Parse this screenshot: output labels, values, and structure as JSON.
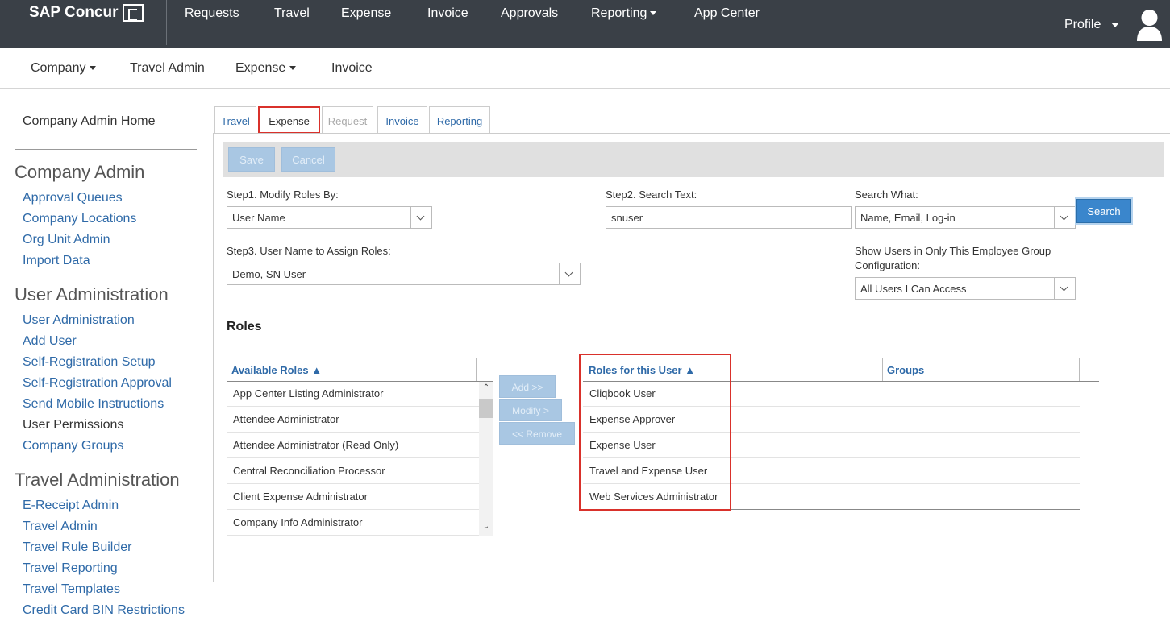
{
  "brand": {
    "name": "SAP Concur"
  },
  "top_nav": {
    "items": [
      "Requests",
      "Travel",
      "Expense",
      "Invoice",
      "Approvals",
      "Reporting",
      "App Center"
    ],
    "profile_label": "Profile"
  },
  "sub_nav": {
    "items": [
      "Company",
      "Travel Admin",
      "Expense",
      "Invoice"
    ]
  },
  "sidebar": {
    "home": "Company Admin Home",
    "sections": [
      {
        "title": "Company Admin",
        "links": [
          "Approval Queues",
          "Company Locations",
          "Org Unit Admin",
          "Import Data"
        ]
      },
      {
        "title": "User Administration",
        "links": [
          "User Administration",
          "Add User",
          "Self-Registration Setup",
          "Self-Registration Approval",
          "Send Mobile Instructions",
          "User Permissions",
          "Company Groups"
        ]
      },
      {
        "title": "Travel Administration",
        "links": [
          "E-Receipt Admin",
          "Travel Admin",
          "Travel Rule Builder",
          "Travel Reporting",
          "Travel Templates",
          "Credit Card BIN Restrictions"
        ]
      }
    ]
  },
  "tabs": [
    "Travel",
    "Expense",
    "Request",
    "Invoice",
    "Reporting"
  ],
  "toolbar": {
    "save": "Save",
    "cancel": "Cancel"
  },
  "form": {
    "step1_label": "Step1. Modify Roles By:",
    "step1_value": "User Name",
    "step2_label": "Step2. Search Text:",
    "step2_value": "snuser",
    "search_what_label": "Search What:",
    "search_what_value": "Name, Email, Log-in",
    "search_button": "Search",
    "step3_label": "Step3. User Name to Assign Roles:",
    "step3_value": "Demo, SN User",
    "group_label_line1": "Show Users in Only This Employee Group",
    "group_label_line2": "Configuration:",
    "group_value": "All Users I Can Access"
  },
  "roles": {
    "heading": "Roles",
    "available_header": "Available Roles",
    "available": [
      "App Center Listing Administrator",
      "Attendee Administrator",
      "Attendee Administrator (Read Only)",
      "Central Reconciliation Processor",
      "Client Expense Administrator",
      "Company Info Administrator"
    ],
    "buttons": {
      "add": "Add >>",
      "modify": "Modify >",
      "remove": "<< Remove"
    },
    "user_header": "Roles for this User",
    "groups_header": "Groups",
    "user_roles": [
      "Cliqbook User",
      "Expense Approver",
      "Expense User",
      "Travel and Expense User",
      "Web Services Administrator"
    ]
  }
}
